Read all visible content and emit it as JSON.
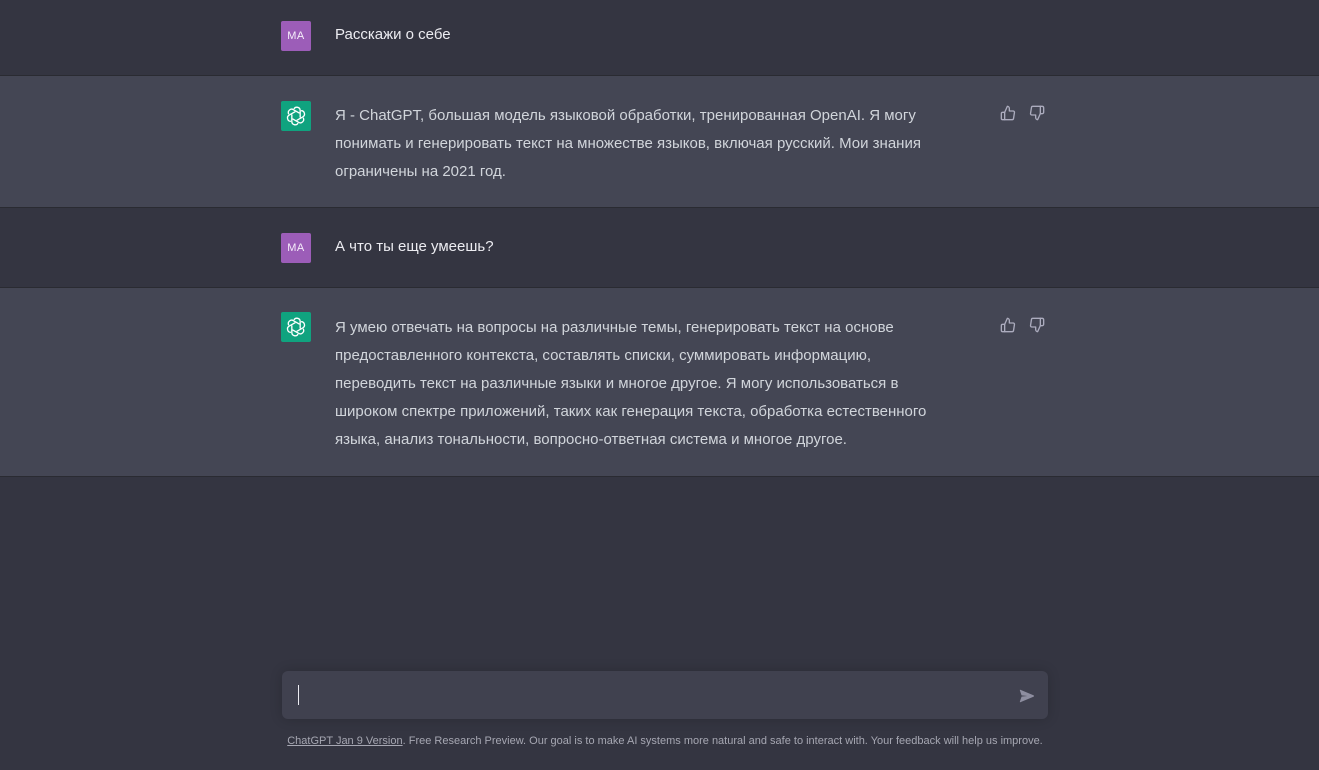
{
  "conversation": [
    {
      "role": "user",
      "avatar_text": "MA",
      "text": "Расскажи о себе"
    },
    {
      "role": "assistant",
      "avatar_icon": "openai-logo-icon",
      "lines": [
        "Я - ChatGPT, большая модель языковой обработки, тренированная OpenAI. Я могу",
        "понимать и генерировать текст на множестве языков, включая русский. Мои знания",
        "ограничены на 2021 год."
      ]
    },
    {
      "role": "user",
      "avatar_text": "MA",
      "text": "А что ты еще умеешь?"
    },
    {
      "role": "assistant",
      "avatar_icon": "openai-logo-icon",
      "lines": [
        "Я умею отвечать на вопросы на различные темы, генерировать текст на основе",
        "предоставленного контекста, составлять списки, суммировать информацию,",
        "переводить текст на различные языки и многое другое. Я могу использоваться в",
        "широком спектре приложений, таких как генерация текста, обработка естественного",
        "языка, анализ тональности, вопросно-ответная система и многое другое."
      ]
    }
  ],
  "composer": {
    "value": "",
    "send_icon": "send-icon"
  },
  "footer": {
    "link_text": "ChatGPT Jan 9 Version",
    "text": ". Free Research Preview. Our goal is to make AI systems more natural and safe to interact with. Your feedback will help us improve."
  },
  "colors": {
    "background": "#343541",
    "assistant_background": "#444654",
    "user_avatar": "#9c5db8",
    "bot_avatar": "#10a37f",
    "composer_background": "#40414f"
  }
}
